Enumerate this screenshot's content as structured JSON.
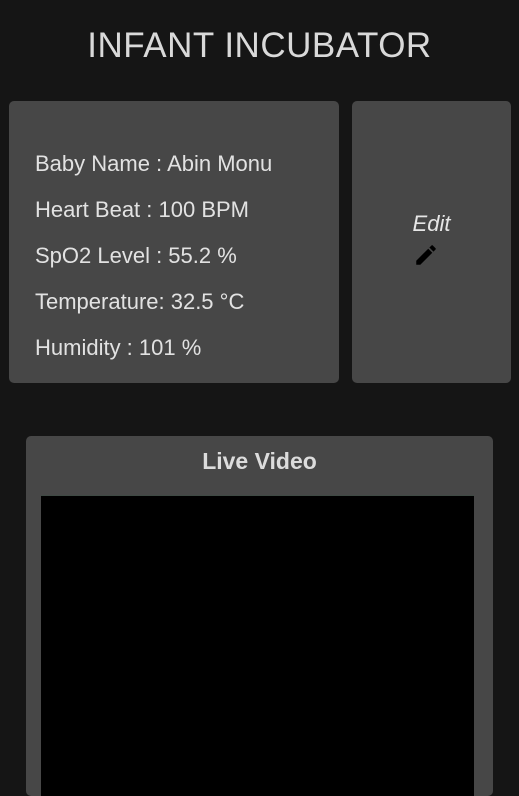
{
  "app": {
    "title": "INFANT INCUBATOR"
  },
  "info_card": {
    "lines": [
      "Baby Name : Abin Monu",
      "Heart Beat : 100 BPM",
      "SpO2 Level : 55.2 %",
      "Temperature: 32.5 °C",
      "Humidity : 101 %"
    ]
  },
  "edit_card": {
    "label": "Edit",
    "icon": "pencil-icon"
  },
  "video_card": {
    "title": "Live Video"
  },
  "colors": {
    "background": "#151515",
    "card": "#474747",
    "text": "#e2e2e2",
    "video": "#000000"
  }
}
